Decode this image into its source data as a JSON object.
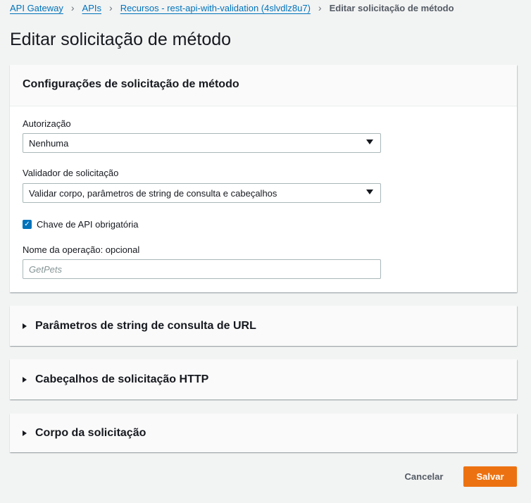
{
  "breadcrumb": {
    "items": [
      "API Gateway",
      "APIs",
      "Recursos - rest-api-with-validation (4slvdlz8u7)"
    ],
    "current": "Editar solicitação de método"
  },
  "page_title": "Editar solicitação de método",
  "settings": {
    "title": "Configurações de solicitação de método",
    "authorization_label": "Autorização",
    "authorization_value": "Nenhuma",
    "validator_label": "Validador de solicitação",
    "validator_value": "Validar corpo, parâmetros de string de consulta e cabeçalhos",
    "api_key_label": "Chave de API obrigatória",
    "api_key_checked": true,
    "operation_label": "Nome da operação: opcional",
    "operation_placeholder": "GetPets"
  },
  "sections": [
    "Parâmetros de string de consulta de URL",
    "Cabeçalhos de solicitação HTTP",
    "Corpo da solicitação"
  ],
  "actions": {
    "cancel": "Cancelar",
    "save": "Salvar"
  }
}
